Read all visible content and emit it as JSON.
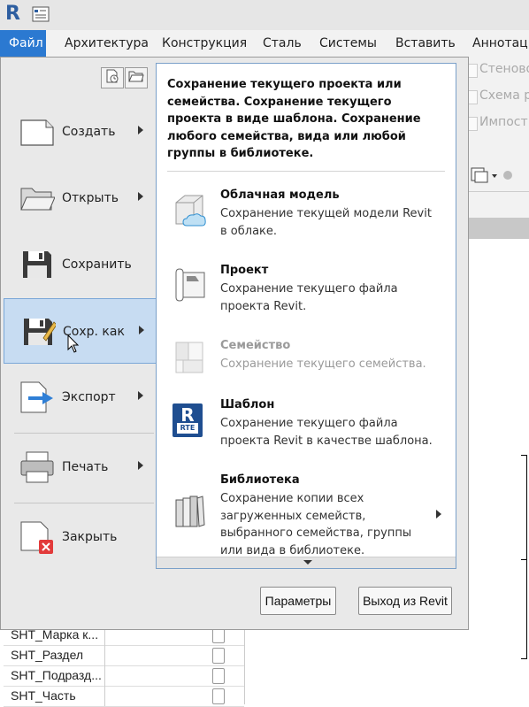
{
  "ribbon": {
    "tabs": [
      {
        "label": "Файл",
        "active": true
      },
      {
        "label": "Архитектура"
      },
      {
        "label": "Конструкция"
      },
      {
        "label": "Сталь"
      },
      {
        "label": "Системы"
      },
      {
        "label": "Вставить"
      },
      {
        "label": "Аннотаци"
      }
    ],
    "behind_items": [
      "Стеново",
      "Схема р",
      "Импост"
    ]
  },
  "app_menu": {
    "items": [
      {
        "label": "Создать",
        "has_submenu": true
      },
      {
        "label": "Открыть",
        "has_submenu": true
      },
      {
        "label": "Сохранить",
        "has_submenu": false
      },
      {
        "label": "Сохр. как",
        "has_submenu": true,
        "active": true
      },
      {
        "label": "Экспорт",
        "has_submenu": true
      },
      {
        "label": "Печать",
        "has_submenu": true
      },
      {
        "label": "Закрыть",
        "has_submenu": false
      }
    ],
    "panel": {
      "heading": "Сохранение текущего проекта или семейства. Сохранение текущего проекта в виде шаблона. Сохранение любого семейства, вида или любой группы в библиотеке.",
      "options": [
        {
          "title": "Облачная модель",
          "desc": "Сохранение текущей модели Revit в облаке.",
          "icon": "cloud-model-icon"
        },
        {
          "title": "Проект",
          "desc": "Сохранение текущего файла проекта Revit.",
          "icon": "project-icon"
        },
        {
          "title": "Семейство",
          "desc": "Сохранение текущего семейства.",
          "icon": "family-icon",
          "disabled": true
        },
        {
          "title": "Шаблон",
          "desc": "Сохранение текущего файла проекта Revit в качестве шаблона.",
          "icon": "template-icon"
        },
        {
          "title": "Библиотека",
          "desc": "Сохранение копии всех загруженных семейств, выбранного семейства, группы или вида в библиотеке.",
          "icon": "library-icon",
          "has_submenu": true
        }
      ]
    },
    "buttons": {
      "options": "Параметры",
      "exit": "Выход из Revit"
    },
    "template_badge": "RTE"
  },
  "background_table": {
    "rows": [
      "SHT_Марка к...",
      "SHT_Раздел",
      "SHT_Подразд...",
      "SHT_Часть"
    ]
  }
}
